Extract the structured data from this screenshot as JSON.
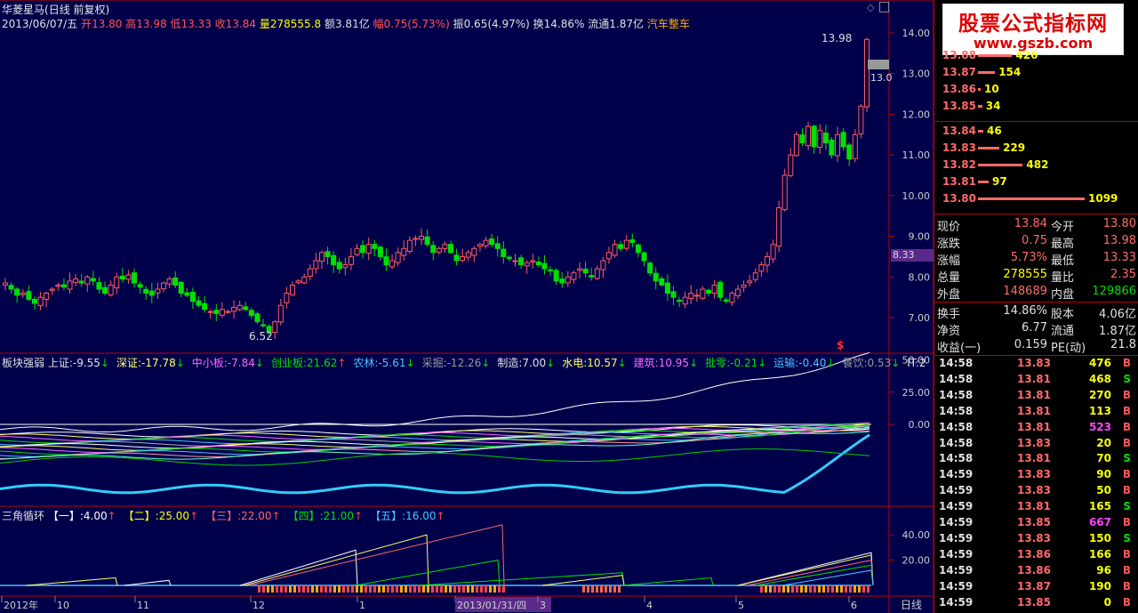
{
  "stock": {
    "name": "华菱星马",
    "mode": "(日线 前复权)"
  },
  "ohlc": {
    "date": "2013/06/07/五",
    "open_label": "开",
    "open": "13.80",
    "high_label": "高",
    "high": "13.98",
    "low_label": "低",
    "low": "13.33",
    "close_label": "收",
    "close": "13.84",
    "vol_label": "量",
    "vol": "278555.8",
    "amount_label": "额",
    "amount": "3.81亿",
    "chg_label": "幅",
    "chg": "0.75(5.73%)",
    "amp_label": "振",
    "amp": "0.65(4.97%)",
    "turn_label": "换",
    "turn": "14.86%",
    "float_label": "流通",
    "float": "1.87亿",
    "sector": "汽车整车"
  },
  "price_axis": [
    "14.00",
    "13.00",
    "12.00",
    "11.00",
    "10.00",
    "9.00",
    "8.00",
    "7.00"
  ],
  "price_annotations": {
    "high": "13.98",
    "low": "6.52",
    "current": "13.0",
    "marker": "8.33",
    "signal": "$"
  },
  "sector_panel": {
    "title": "板块强弱",
    "items": [
      {
        "label": "上证:",
        "value": "-9.55",
        "arrow": "↓",
        "color": "#e0e0e0"
      },
      {
        "label": "深证:",
        "value": "-17.78",
        "arrow": "↓",
        "color": "#ffff66"
      },
      {
        "label": "中小板:",
        "value": "-7.84",
        "arrow": "↓",
        "color": "#ff66ff"
      },
      {
        "label": "创业板:",
        "value": "21.62",
        "arrow": "↑",
        "color": "#00e000"
      },
      {
        "label": "农林:",
        "value": "-5.61",
        "arrow": "↓",
        "color": "#4cc3ff"
      },
      {
        "label": "采掘:",
        "value": "-12.26",
        "arrow": "↓",
        "color": "#999999"
      },
      {
        "label": "制造:",
        "value": "7.00",
        "arrow": "↓",
        "color": "#e0e0e0"
      },
      {
        "label": "水电:",
        "value": "10.57",
        "arrow": "↓",
        "color": "#ffff66"
      },
      {
        "label": "建筑:",
        "value": "10.95",
        "arrow": "↓",
        "color": "#ff66ff"
      },
      {
        "label": "批零:",
        "value": "-0.21",
        "arrow": "↓",
        "color": "#00e000"
      },
      {
        "label": "运输:",
        "value": "-0.40",
        "arrow": "↓",
        "color": "#4cc3ff"
      },
      {
        "label": "餐饮:",
        "value": "0.53",
        "arrow": "↓",
        "color": "#999999"
      },
      {
        "label": "IT:",
        "value": "2",
        "arrow": "",
        "color": "#e0e0e0"
      }
    ],
    "axis": [
      "50.00",
      "25.00",
      "0.00"
    ]
  },
  "triangle_panel": {
    "title": "三角循环",
    "items": [
      {
        "label": "【一】:",
        "value": "4.00",
        "arrow": "↑",
        "color": "#ffffff"
      },
      {
        "label": "【二】:",
        "value": "25.00",
        "arrow": "↑",
        "color": "#ffff00"
      },
      {
        "label": "【三】:",
        "value": "22.00",
        "arrow": "↑",
        "color": "#ff6666"
      },
      {
        "label": "【四】:",
        "value": "21.00",
        "arrow": "↑",
        "color": "#00e000"
      },
      {
        "label": "【五】:",
        "value": "16.00",
        "arrow": "↑",
        "color": "#4cc3ff"
      }
    ],
    "axis": [
      "40.00",
      "20.00"
    ]
  },
  "time_axis": {
    "labels": [
      "2012年",
      "10",
      "11",
      "12",
      "1",
      "2013/01/31/四",
      "3",
      "4",
      "5",
      "6"
    ],
    "period": "日线"
  },
  "logo": {
    "line1": "股票公式指标网",
    "line2": "www.gszb.com"
  },
  "order_book": {
    "asks": [
      {
        "price": "13.88",
        "vol": "426",
        "bar": 0.32
      },
      {
        "price": "13.87",
        "vol": "154",
        "bar": 0.16
      },
      {
        "price": "13.86",
        "vol": "10",
        "bar": 0.02
      },
      {
        "price": "13.85",
        "vol": "34",
        "bar": 0.04
      }
    ],
    "bids": [
      {
        "price": "13.84",
        "vol": "46",
        "bar": 0.05
      },
      {
        "price": "13.83",
        "vol": "229",
        "bar": 0.2
      },
      {
        "price": "13.82",
        "vol": "482",
        "bar": 0.42
      },
      {
        "price": "13.81",
        "vol": "97",
        "bar": 0.1
      },
      {
        "price": "13.80",
        "vol": "1099",
        "bar": 1.0
      }
    ]
  },
  "stats": [
    {
      "l1": "现价",
      "v1": "13.84",
      "l2": "今开",
      "v2": "13.80",
      "c1": "#ff6b6b",
      "c2": "#ff6b6b"
    },
    {
      "l1": "涨跌",
      "v1": "0.75",
      "l2": "最高",
      "v2": "13.98",
      "c1": "#ff6b6b",
      "c2": "#ff6b6b"
    },
    {
      "l1": "涨幅",
      "v1": "5.73%",
      "l2": "最低",
      "v2": "13.33",
      "c1": "#ff6b6b",
      "c2": "#ff6b6b"
    },
    {
      "l1": "总量",
      "v1": "278555",
      "l2": "量比",
      "v2": "2.35",
      "c1": "#ffff00",
      "c2": "#ff6b6b"
    },
    {
      "l1": "外盘",
      "v1": "148689",
      "l2": "内盘",
      "v2": "129866",
      "c1": "#ff6b6b",
      "c2": "#00e000"
    },
    {
      "l1": "换手",
      "v1": "14.86%",
      "l2": "股本",
      "v2": "4.06亿",
      "c1": "#e0e0e0",
      "c2": "#e0e0e0"
    },
    {
      "l1": "净资",
      "v1": "6.77",
      "l2": "流通",
      "v2": "1.87亿",
      "c1": "#e0e0e0",
      "c2": "#e0e0e0"
    },
    {
      "l1": "收益(一)",
      "v1": "0.159",
      "l2": "PE(动)",
      "v2": "21.8",
      "c1": "#e0e0e0",
      "c2": "#e0e0e0"
    }
  ],
  "ticks": [
    {
      "t": "14:58",
      "p": "13.83",
      "v": "476",
      "s": "B"
    },
    {
      "t": "14:58",
      "p": "13.81",
      "v": "468",
      "s": "S"
    },
    {
      "t": "14:58",
      "p": "13.81",
      "v": "270",
      "s": "B"
    },
    {
      "t": "14:58",
      "p": "13.81",
      "v": "113",
      "s": "B"
    },
    {
      "t": "14:58",
      "p": "13.81",
      "v": "523",
      "s": "B",
      "mag": true
    },
    {
      "t": "14:58",
      "p": "13.83",
      "v": "20",
      "s": "B"
    },
    {
      "t": "14:58",
      "p": "13.81",
      "v": "70",
      "s": "S"
    },
    {
      "t": "14:59",
      "p": "13.83",
      "v": "90",
      "s": "B"
    },
    {
      "t": "14:59",
      "p": "13.83",
      "v": "50",
      "s": "B"
    },
    {
      "t": "14:59",
      "p": "13.81",
      "v": "165",
      "s": "S"
    },
    {
      "t": "14:59",
      "p": "13.85",
      "v": "667",
      "s": "B",
      "mag": true
    },
    {
      "t": "14:59",
      "p": "13.83",
      "v": "150",
      "s": "S"
    },
    {
      "t": "14:59",
      "p": "13.86",
      "v": "166",
      "s": "B"
    },
    {
      "t": "14:59",
      "p": "13.86",
      "v": "96",
      "s": "B"
    },
    {
      "t": "14:59",
      "p": "13.87",
      "v": "190",
      "s": "B"
    },
    {
      "t": "14:59",
      "p": "13.85",
      "v": "0",
      "s": "B"
    }
  ],
  "chart_data": {
    "type": "candlestick",
    "ylim": [
      6.3,
      14.4
    ],
    "closes_note": "daily closes Sep 2012 – Jun 2013 (approx)",
    "closes": [
      7.85,
      7.7,
      7.55,
      7.6,
      7.45,
      7.35,
      7.5,
      7.6,
      7.7,
      7.8,
      7.75,
      7.9,
      7.95,
      7.85,
      8.0,
      7.9,
      7.7,
      7.6,
      7.8,
      8.0,
      7.95,
      8.05,
      7.85,
      7.75,
      7.6,
      7.55,
      7.7,
      7.85,
      7.95,
      7.8,
      7.6,
      7.55,
      7.4,
      7.3,
      7.2,
      7.15,
      7.1,
      7.2,
      7.15,
      7.25,
      7.3,
      7.2,
      7.05,
      6.9,
      6.8,
      6.65,
      6.9,
      7.3,
      7.6,
      7.8,
      7.9,
      8.0,
      8.2,
      8.4,
      8.6,
      8.5,
      8.3,
      8.2,
      8.3,
      8.5,
      8.7,
      8.6,
      8.8,
      8.7,
      8.5,
      8.3,
      8.4,
      8.6,
      8.7,
      8.9,
      8.95,
      9.0,
      8.8,
      8.6,
      8.7,
      8.8,
      8.6,
      8.4,
      8.5,
      8.6,
      8.7,
      8.8,
      8.9,
      8.8,
      8.7,
      8.5,
      8.45,
      8.4,
      8.3,
      8.35,
      8.4,
      8.3,
      8.2,
      8.15,
      7.9,
      7.85,
      8.0,
      8.1,
      8.2,
      8.1,
      8.0,
      8.2,
      8.4,
      8.6,
      8.8,
      8.7,
      8.9,
      8.85,
      8.6,
      8.4,
      8.1,
      7.9,
      7.8,
      7.6,
      7.5,
      7.4,
      7.5,
      7.6,
      7.55,
      7.7,
      7.6,
      7.8,
      7.5,
      7.4,
      7.6,
      7.7,
      7.8,
      7.9,
      8.1,
      8.3,
      8.5,
      8.8,
      9.7,
      10.5,
      11.0,
      11.5,
      11.3,
      11.7,
      11.2,
      11.6,
      11.3,
      11.0,
      11.5,
      11.2,
      10.9,
      11.5,
      12.2,
      13.84
    ]
  }
}
